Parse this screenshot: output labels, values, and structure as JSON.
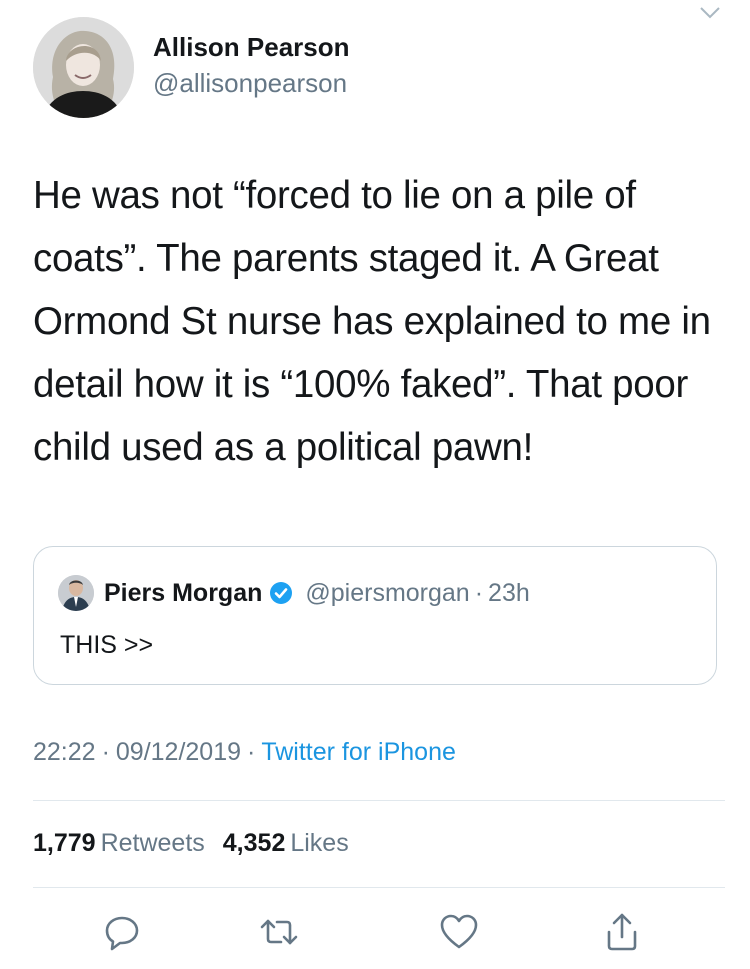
{
  "tweet": {
    "author": {
      "display_name": "Allison Pearson",
      "handle": "@allisonpearson"
    },
    "text": "He was not “forced to lie on a pile of coats”. The parents staged it. A Great Ormond St nurse has explained to me in detail how it is “100% faked”. That poor child used as a political pawn!",
    "quoted": {
      "display_name": "Piers Morgan",
      "verified": true,
      "handle": "@piersmorgan",
      "separator": "·",
      "time": "23h",
      "text": "THIS >>"
    },
    "meta": {
      "time": "22:22",
      "separator": "·",
      "date": "09/12/2019",
      "source": "Twitter for iPhone"
    },
    "stats": {
      "retweets_count": "1,779",
      "retweets_label": "Retweets",
      "likes_count": "4,352",
      "likes_label": "Likes"
    }
  },
  "icons": {
    "menu": "chevron-down-icon",
    "reply": "reply-icon",
    "retweet": "retweet-icon",
    "like": "heart-icon",
    "share": "share-icon",
    "verified": "verified-badge-icon"
  },
  "colors": {
    "text": "#14171a",
    "secondary": "#657786",
    "link": "#1b95e0",
    "border": "#ccd6dd",
    "divider": "#e1e8ed"
  }
}
